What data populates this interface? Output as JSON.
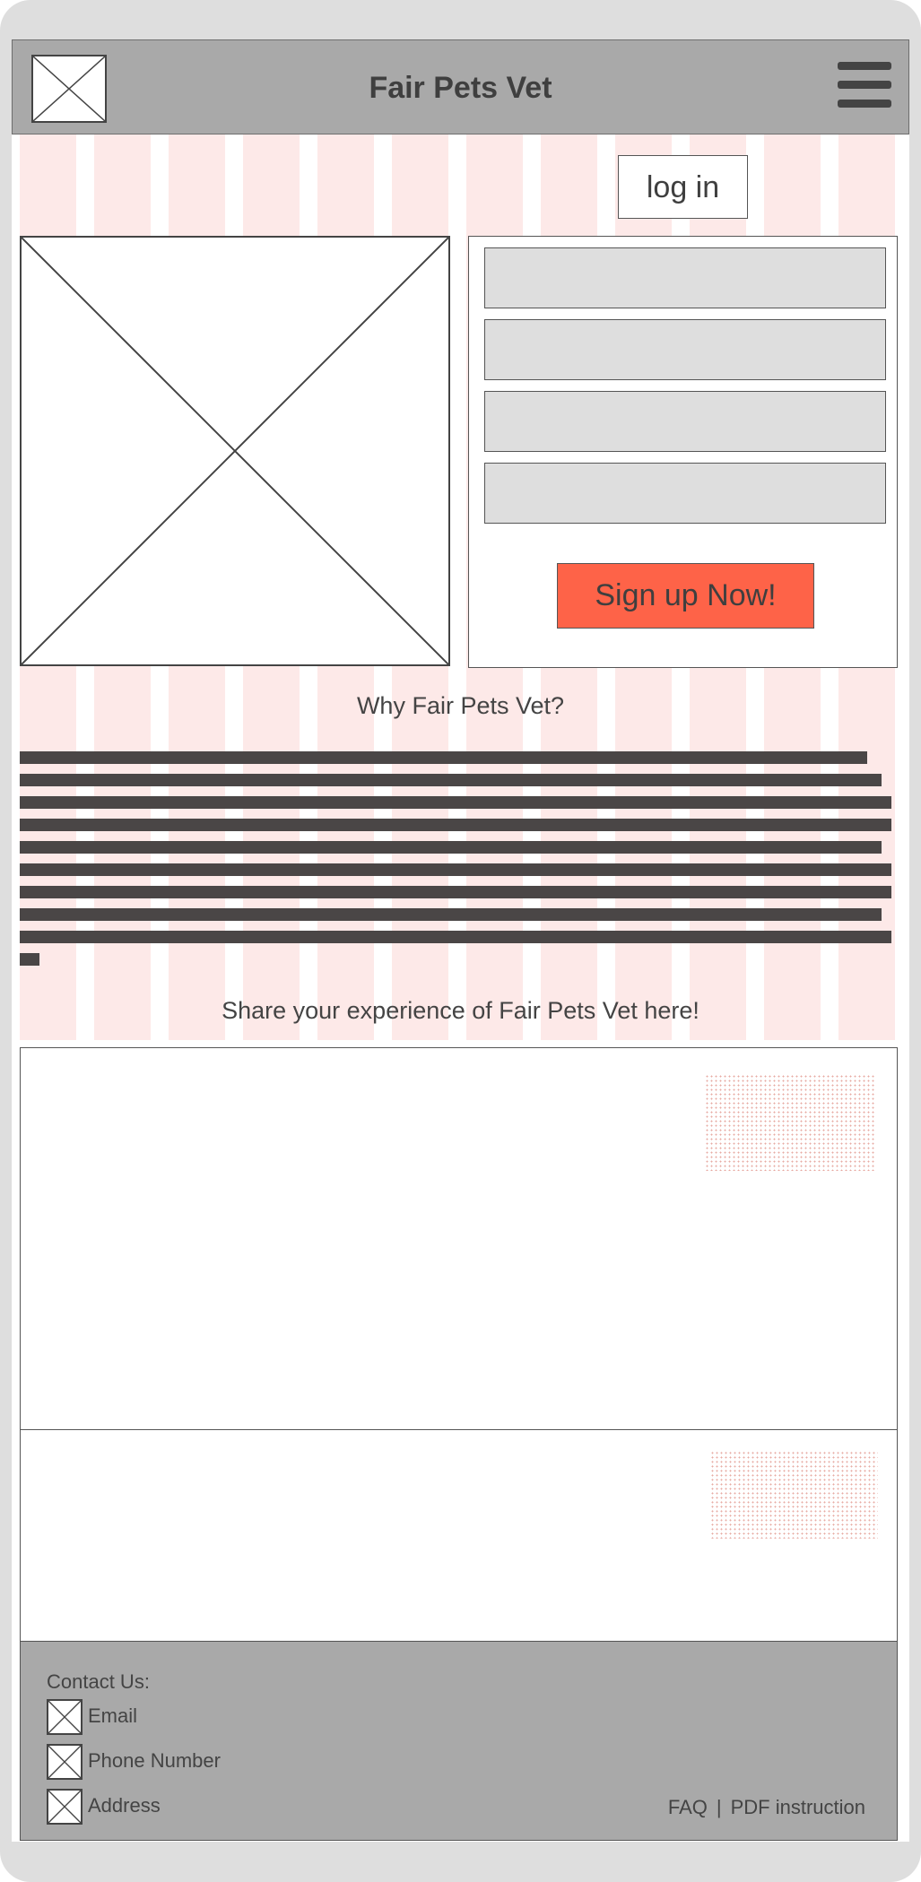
{
  "header": {
    "title": "Fair Pets Vet",
    "logo_icon": "image-placeholder-icon",
    "menu_icon": "hamburger-menu-icon"
  },
  "auth": {
    "login_label": "log in"
  },
  "signup": {
    "fields": [
      {
        "placeholder": "",
        "value": ""
      },
      {
        "placeholder": "",
        "value": ""
      },
      {
        "placeholder": "",
        "value": ""
      },
      {
        "placeholder": "",
        "value": ""
      }
    ],
    "button_label": "Sign up Now!"
  },
  "why": {
    "title": "Why Fair Pets Vet?"
  },
  "share": {
    "title": "Share your experience of Fair Pets Vet here!"
  },
  "footer": {
    "contact_title": "Contact Us:",
    "contacts": [
      {
        "label": "Email",
        "icon": "image-placeholder-icon"
      },
      {
        "label": "Phone Number",
        "icon": "image-placeholder-icon"
      },
      {
        "label": "Address",
        "icon": "image-placeholder-icon"
      }
    ],
    "links": [
      "FAQ",
      "PDF instruction"
    ],
    "separator": "|"
  },
  "colors": {
    "header_bg": "#a9a9a9",
    "accent": "#fe6348",
    "stripe": "#fde9e8",
    "field_bg": "#dedede",
    "text": "#3f3f3f"
  }
}
